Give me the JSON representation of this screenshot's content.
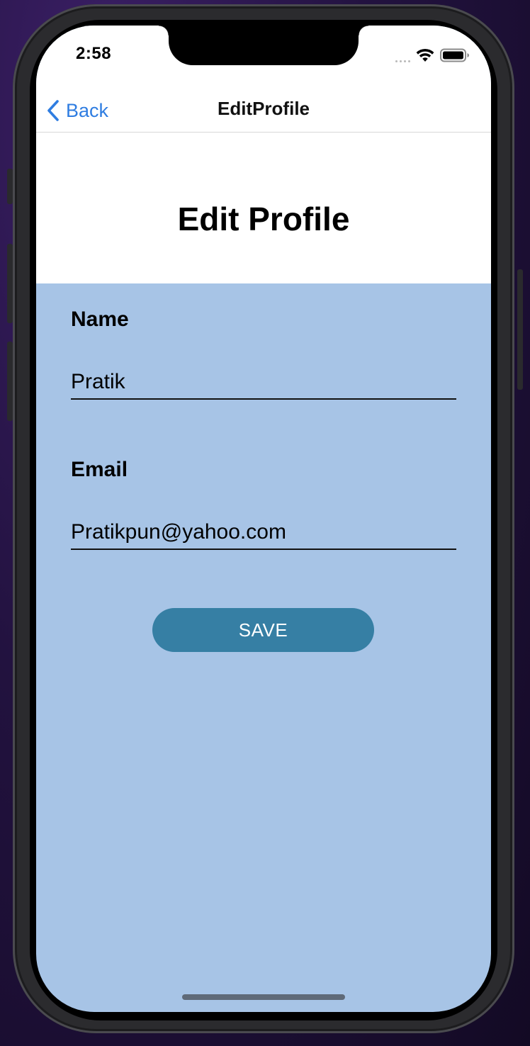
{
  "status_bar": {
    "time": "2:58",
    "icons": [
      "cellular-dots-icon",
      "wifi-icon",
      "battery-icon"
    ]
  },
  "nav": {
    "back_label": "Back",
    "title": "EditProfile",
    "back_icon": "chevron-left-icon"
  },
  "page": {
    "title": "Edit Profile"
  },
  "form": {
    "name_label": "Name",
    "name_value": "Pratik",
    "email_label": "Email",
    "email_value": "Pratikpun@yahoo.com",
    "save_label": "SAVE"
  },
  "colors": {
    "accent": "#2f7de1",
    "form_background": "#a7c4e6",
    "save_button": "#367fa4"
  }
}
